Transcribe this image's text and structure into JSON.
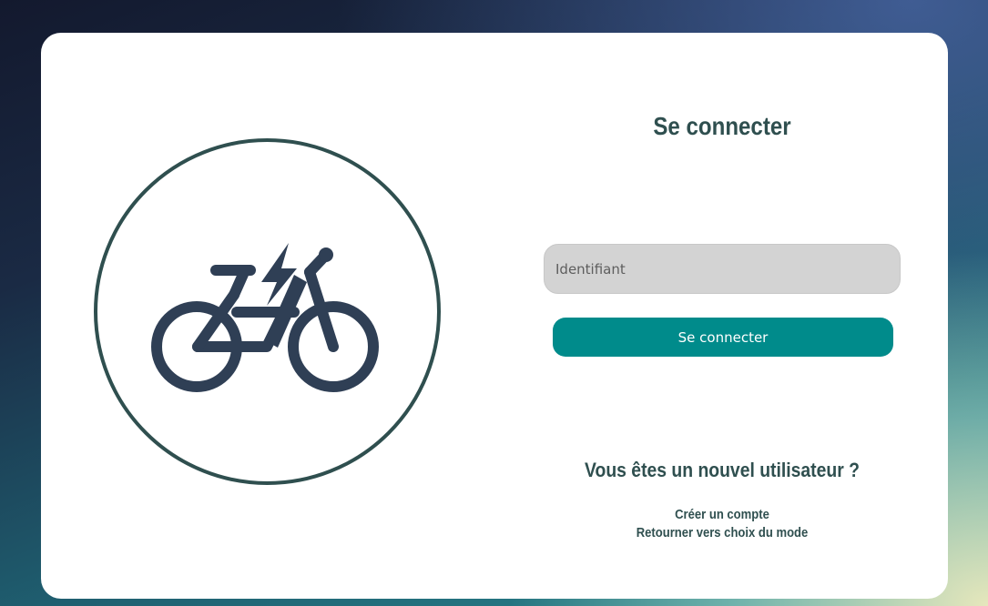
{
  "login": {
    "title": "Se connecter",
    "identifiant_placeholder": "Identifiant",
    "identifiant_value": "",
    "submit_label": "Se connecter"
  },
  "new_user": {
    "question": "Vous êtes un nouvel utilisateur ?",
    "create_account": "Créer un compte",
    "back_to_mode": "Retourner vers choix du mode"
  },
  "logo": {
    "icon": "electric-bike-icon",
    "ring_color": "#2f4f4f",
    "icon_color": "#2f3f55"
  },
  "colors": {
    "accent": "#008b8b",
    "heading": "#2f4f4f",
    "input_bg": "#d3d3d3"
  }
}
